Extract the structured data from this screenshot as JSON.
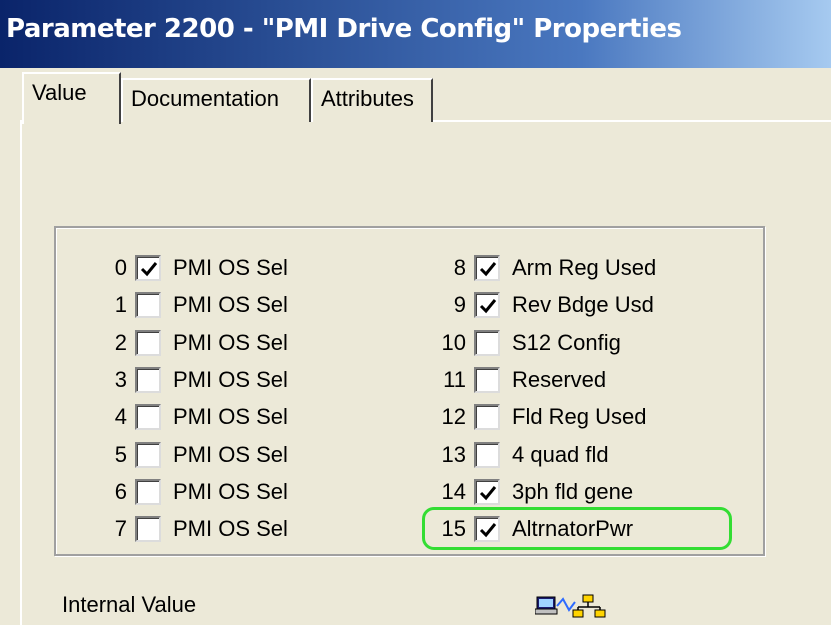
{
  "window": {
    "title": "Parameter 2200 - \"PMI Drive Config\" Properties"
  },
  "tabs": [
    {
      "label": "Value",
      "active": true
    },
    {
      "label": "Documentation",
      "active": false
    },
    {
      "label": "Attributes",
      "active": false
    }
  ],
  "bits_left": [
    {
      "num": "0",
      "label": "PMI OS Sel",
      "checked": true
    },
    {
      "num": "1",
      "label": "PMI OS Sel",
      "checked": false
    },
    {
      "num": "2",
      "label": "PMI OS Sel",
      "checked": false
    },
    {
      "num": "3",
      "label": "PMI OS Sel",
      "checked": false
    },
    {
      "num": "4",
      "label": "PMI OS Sel",
      "checked": false
    },
    {
      "num": "5",
      "label": "PMI OS Sel",
      "checked": false
    },
    {
      "num": "6",
      "label": "PMI OS Sel",
      "checked": false
    },
    {
      "num": "7",
      "label": "PMI OS Sel",
      "checked": false
    }
  ],
  "bits_right": [
    {
      "num": "8",
      "label": "Arm Reg Used",
      "checked": true
    },
    {
      "num": "9",
      "label": "Rev Bdge Usd",
      "checked": true
    },
    {
      "num": "10",
      "label": "S12 Config",
      "checked": false
    },
    {
      "num": "11",
      "label": "Reserved",
      "checked": false
    },
    {
      "num": "12",
      "label": "Fld Reg Used",
      "checked": false
    },
    {
      "num": "13",
      "label": "4 quad fld",
      "checked": false
    },
    {
      "num": "14",
      "label": "3ph fld gene",
      "checked": true
    },
    {
      "num": "15",
      "label": "AltrnatorPwr",
      "checked": true
    }
  ],
  "footer": {
    "internal_value_label": "Internal Value",
    "icon": "network-link-icon"
  },
  "colors": {
    "dialog_bg": "#ece9d8",
    "title_start": "#0a246a",
    "title_end": "#a6caf0",
    "highlight": "#33dd33"
  }
}
